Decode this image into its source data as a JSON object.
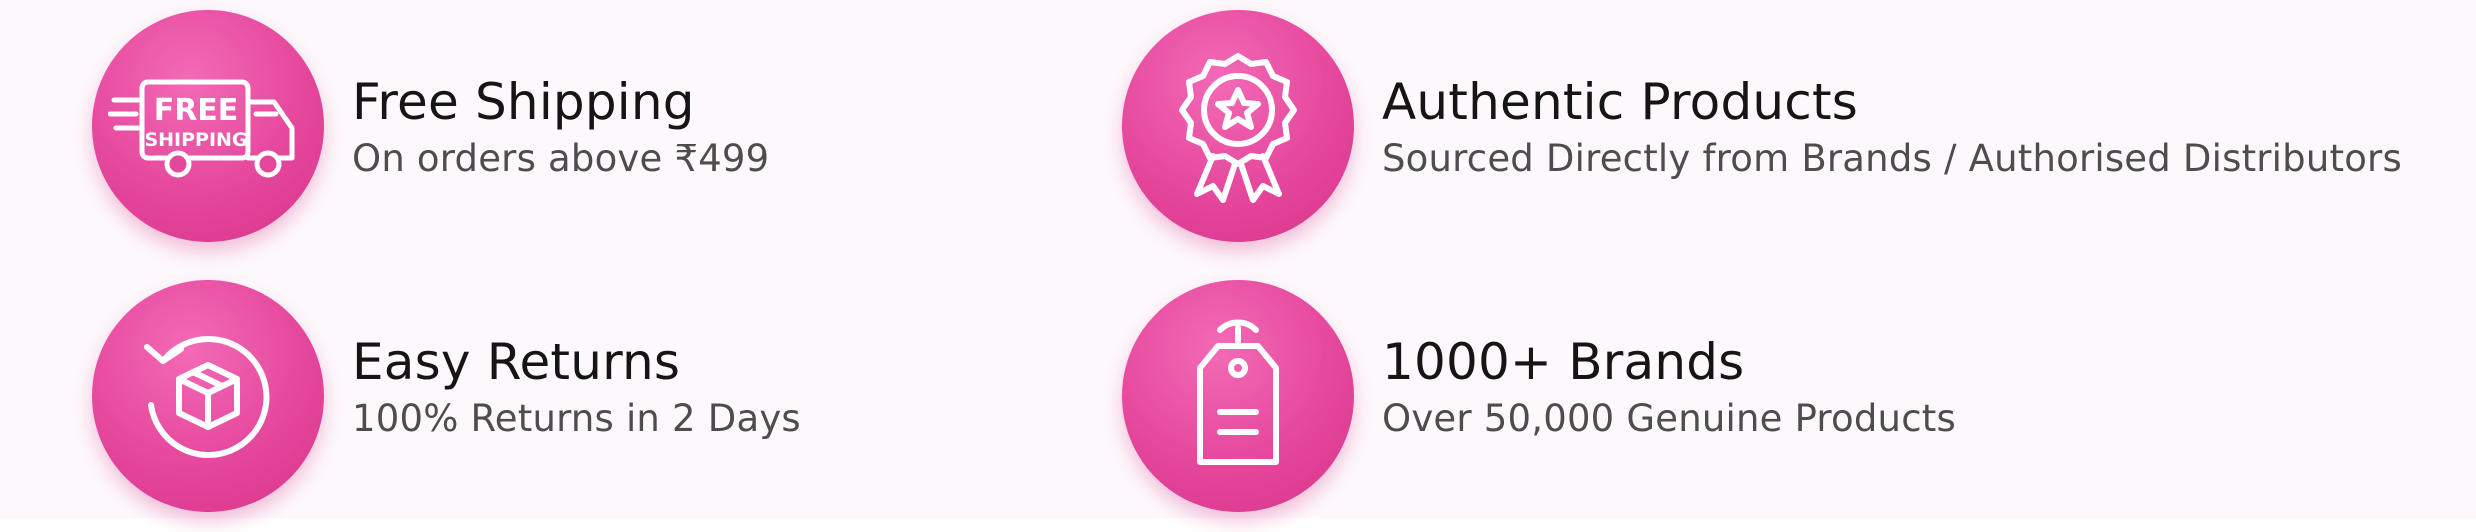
{
  "features": [
    {
      "icon": "free-shipping-truck-icon",
      "badge_text_line1": "FREE",
      "badge_text_line2": "SHIPPING",
      "title": "Free Shipping",
      "subtitle": "On orders above ₹499"
    },
    {
      "icon": "award-ribbon-star-icon",
      "title": "Authentic Products",
      "subtitle": "Sourced Directly from Brands / Authorised Distributors"
    },
    {
      "icon": "return-box-icon",
      "title": "Easy Returns",
      "subtitle": "100% Returns in 2 Days"
    },
    {
      "icon": "price-tag-icon",
      "title": "1000+ Brands",
      "subtitle": "Over 50,000 Genuine Products"
    }
  ],
  "colors": {
    "badge_pink": "#e5479c",
    "badge_pink_light": "#f36ab6",
    "badge_pink_dark": "#d83389",
    "background": "#fdf8fb",
    "title_text": "#151515",
    "subtitle_text": "#4d4d4d"
  }
}
